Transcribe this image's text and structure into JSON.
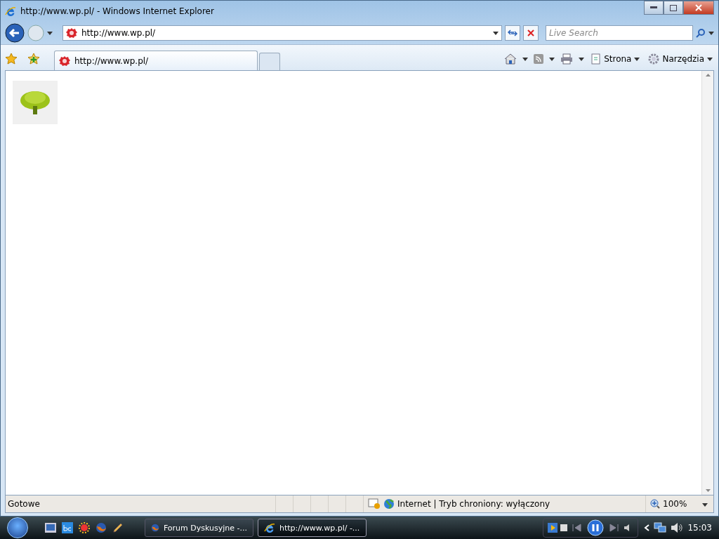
{
  "window": {
    "title": "http://www.wp.pl/ - Windows Internet Explorer"
  },
  "address_bar": {
    "value": "http://www.wp.pl/"
  },
  "search": {
    "placeholder": "Live Search"
  },
  "tabs": [
    {
      "label": "http://www.wp.pl/",
      "selected": true
    }
  ],
  "command_bar": {
    "menus": [
      "Strona",
      "Narzędzia"
    ]
  },
  "status_bar": {
    "text": "Gotowe",
    "zone": "Internet | Tryb chroniony: wyłączony",
    "zoom": "100%"
  },
  "taskbar": {
    "buttons": [
      {
        "label": "Forum Dyskusyjne -...",
        "selected": false
      },
      {
        "label": "http://www.wp.pl/ -...",
        "selected": true
      }
    ],
    "clock": "15:03"
  }
}
